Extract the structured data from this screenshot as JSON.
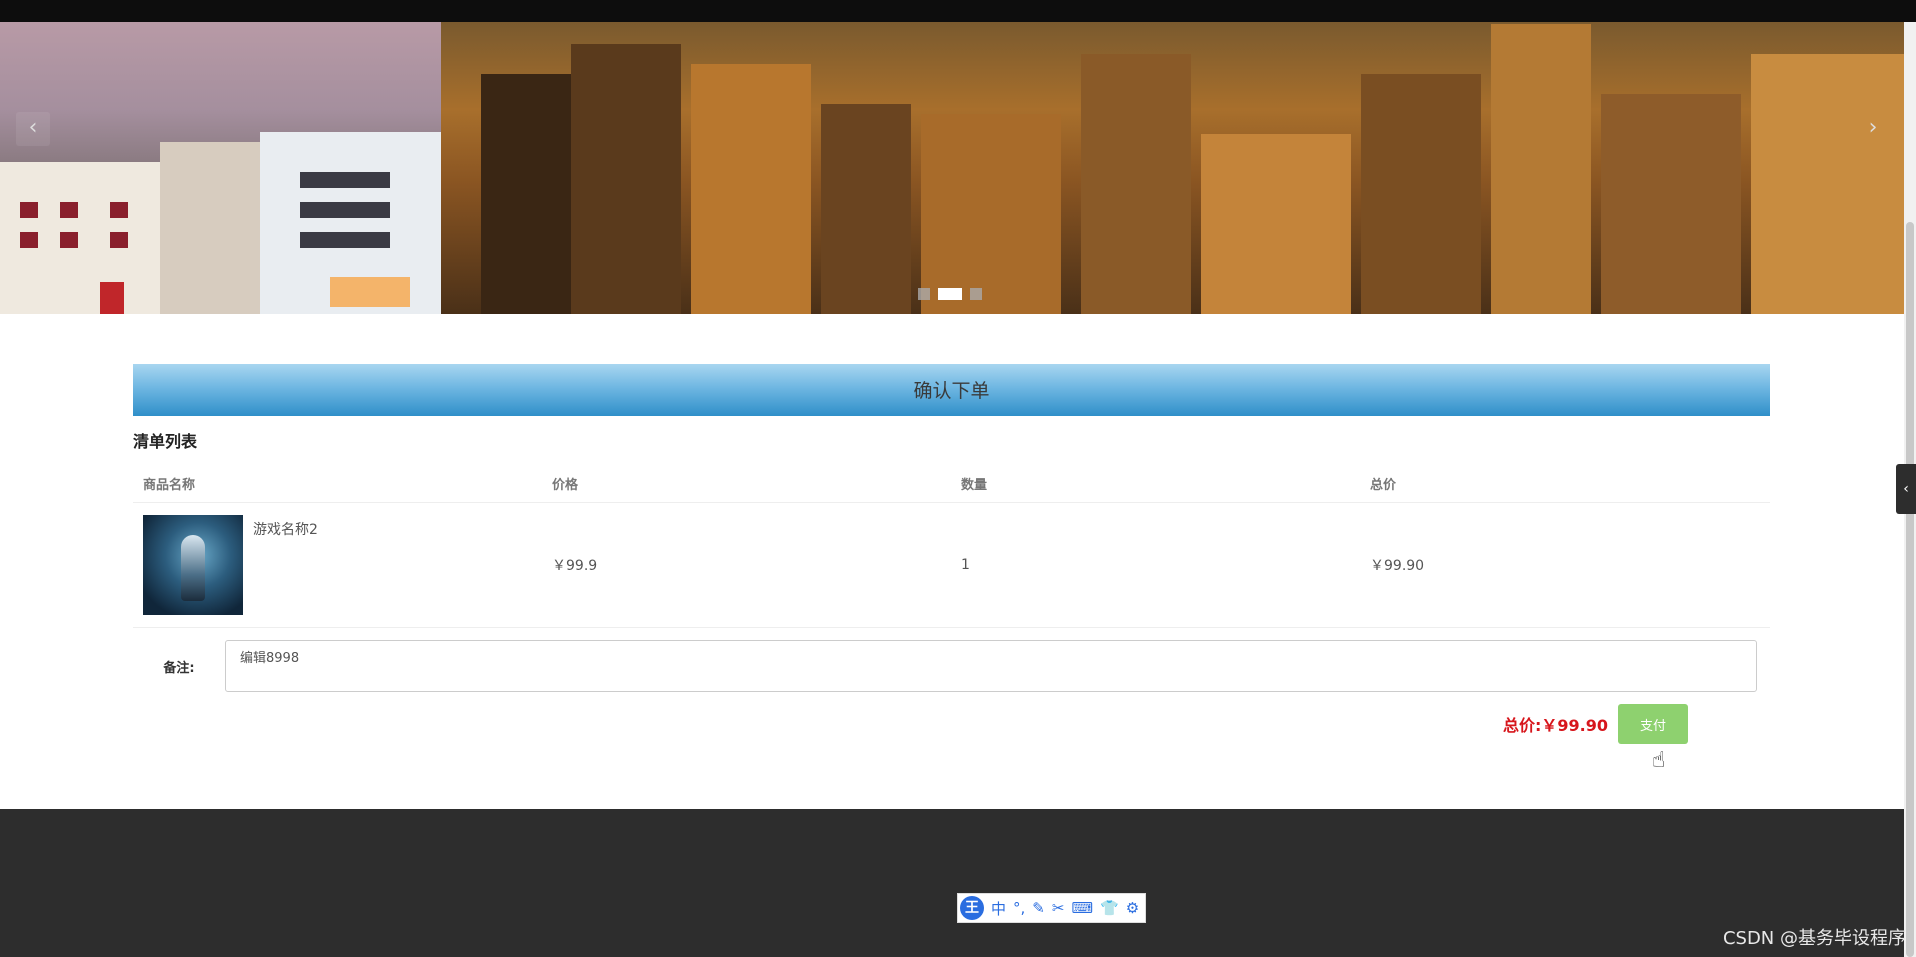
{
  "carousel": {
    "prev_icon": "‹",
    "next_icon": "›",
    "dots": 3,
    "active_dot": 2
  },
  "order": {
    "section_title": "确认下单",
    "list_title": "清单列表",
    "columns": [
      "商品名称",
      "价格",
      "数量",
      "总价"
    ],
    "items": [
      {
        "name": "游戏名称2",
        "price": "￥99.9",
        "quantity": "1",
        "subtotal": "￥99.90"
      }
    ],
    "remark_label": "备注:",
    "remark_value": "编辑8998",
    "total_label": "总价:",
    "total_value": "￥99.90",
    "pay_label": "支付"
  },
  "side_toggle_icon": "‹",
  "ime_toolbar": {
    "logo": "王",
    "items": [
      "中",
      "°,",
      "✎",
      "✂",
      "⌨",
      "👕",
      "⚙"
    ]
  },
  "watermark": "CSDN @基务毕设程序"
}
